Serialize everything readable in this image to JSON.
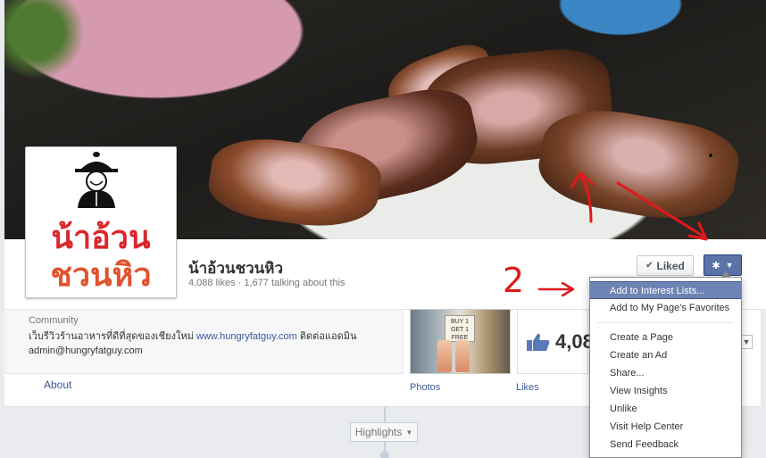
{
  "page": {
    "name": "น้าอ้วนชวนหิว",
    "likes": "4,088 likes",
    "talking": "1,677 talking about this",
    "profile_logo_line1": "น้าอ้วน",
    "profile_logo_line2": "ชวนหิว"
  },
  "actions": {
    "liked_label": "Liked",
    "check_icon": "✔",
    "gear_icon": "✱",
    "caret_icon": "▼"
  },
  "about": {
    "category": "Community",
    "description_prefix": "เว็บรีวิวร้านอาหารที่ดีที่สุดของเชียงใหม่ ",
    "website": "www.hungryfatguy.com",
    "description_suffix": " ติดต่อแอดมิน",
    "email": "admin@hungryfatguy.com",
    "about_label": "About"
  },
  "photos": {
    "label": "Photos",
    "sign_text": "BUY 1 GET 1 FREE"
  },
  "likes_box": {
    "count": "4,08",
    "label": "Likes"
  },
  "timeline": {
    "highlights_label": "Highlights",
    "caret": "▼"
  },
  "dropdown": {
    "items": [
      {
        "label": "Add to Interest Lists..."
      },
      {
        "label": "Add to My Page's Favorites"
      },
      {
        "label": "Create a Page"
      },
      {
        "label": "Create an Ad"
      },
      {
        "label": "Share..."
      },
      {
        "label": "View Insights"
      },
      {
        "label": "Unlike"
      },
      {
        "label": "Visit Help Center"
      },
      {
        "label": "Send Feedback"
      }
    ]
  },
  "annotation": {
    "number": "2",
    "arrow": "→",
    "color": "#e0191b"
  },
  "colors": {
    "fb_blue": "#3b5998",
    "menu_highlight": "#6d84b4"
  }
}
